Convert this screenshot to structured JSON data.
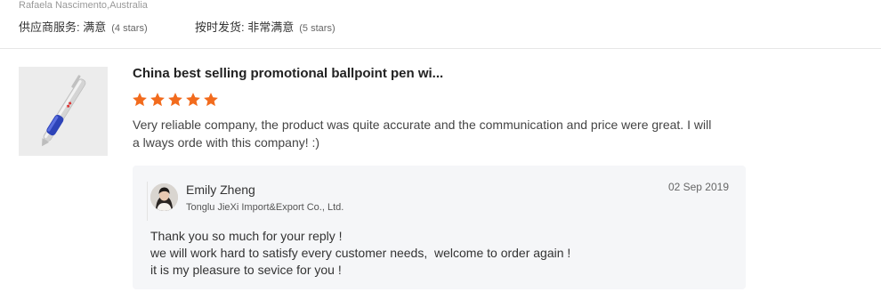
{
  "previous_review": {
    "reviewer": "Rafaela Nascimento,Australia",
    "ratings": [
      {
        "label": "供应商服务:",
        "value": "满意",
        "stars_note": "(4 stars)"
      },
      {
        "label": "按时发货:",
        "value": "非常满意",
        "stars_note": "(5 stars)"
      }
    ]
  },
  "review": {
    "product_title": "China best selling promotional ballpoint pen wi...",
    "rating": 5,
    "max_rating": 5,
    "star_color": "#f26b1d",
    "text": "Very reliable company, the product was quite accurate and the communication and price were great. I will a lways orde with this company! :)"
  },
  "reply": {
    "name": "Emily Zheng",
    "company": "Tonglu JieXi Import&Export Co., Ltd.",
    "date": "02 Sep 2019",
    "lines": [
      "Thank you so much for your reply !",
      "we will work hard to satisfy every customer needs,  welcome to order again !",
      "it is my pleasure to sevice for you !"
    ]
  }
}
